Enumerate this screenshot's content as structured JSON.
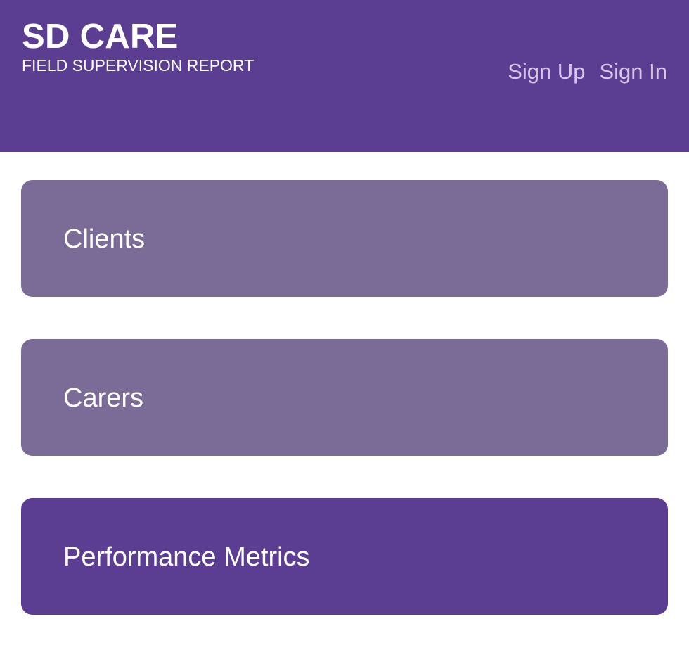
{
  "header": {
    "title": "SD CARE",
    "subtitle": "FIELD SUPERVISION REPORT",
    "sign_up_label": "Sign Up",
    "sign_in_label": "Sign In"
  },
  "cards": [
    {
      "label": "Clients",
      "color": "#7b6c97"
    },
    {
      "label": "Carers",
      "color": "#7b6c97"
    },
    {
      "label": "Performance Metrics",
      "color": "#5b3e92"
    }
  ],
  "colors": {
    "brand": "#5b3e92",
    "card_inactive": "#7b6c97",
    "link": "#d8c5e9"
  }
}
